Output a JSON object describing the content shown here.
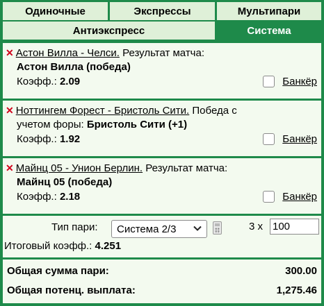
{
  "tabs": {
    "singles": "Одиночные",
    "express": "Экспрессы",
    "multi": "Мультипари",
    "antiexpress": "Антиэкспресс",
    "system": "Система"
  },
  "bets": [
    {
      "event": "Астон Вилла - Челси.",
      "market": " Результат матча:",
      "selection": "Астон Вилла (победа)",
      "odds_label": "Коэфф.:",
      "odds": "2.09",
      "banker_label": "Банкёр"
    },
    {
      "event": "Ноттингем Форест - Бристоль Сити.",
      "market": " Победа с",
      "market_cont": "учетом форы: ",
      "selection": "Бристоль Сити (+1)",
      "odds_label": "Коэфф.:",
      "odds": "1.92",
      "banker_label": "Банкёр"
    },
    {
      "event": "Майнц 05 - Унион Берлин.",
      "market": " Результат матча:",
      "selection": "Майнц 05 (победа)",
      "odds_label": "Коэфф.:",
      "odds": "2.18",
      "banker_label": "Банкёр"
    }
  ],
  "system": {
    "type_label": "Тип пари:",
    "type_value": "Система 2/3",
    "multiplier": "3 x",
    "stake": "100",
    "total_odds_label": "Итоговый коэфф.:",
    "total_odds": "4.251"
  },
  "summary": {
    "total_stake_label": "Общая сумма пари:",
    "total_stake": "300.00",
    "potential_payout_label": "Общая потенц. выплата:",
    "potential_payout": "1,275.46"
  },
  "colors": {
    "brand_green": "#1e8a4a",
    "tab_bg": "#dff0d8",
    "panel_bg": "#f3faef",
    "remove_red": "#d0021b"
  },
  "icons": {
    "remove": "x-icon",
    "dropdown": "chevron-down-icon",
    "calculator": "calculator-icon"
  }
}
